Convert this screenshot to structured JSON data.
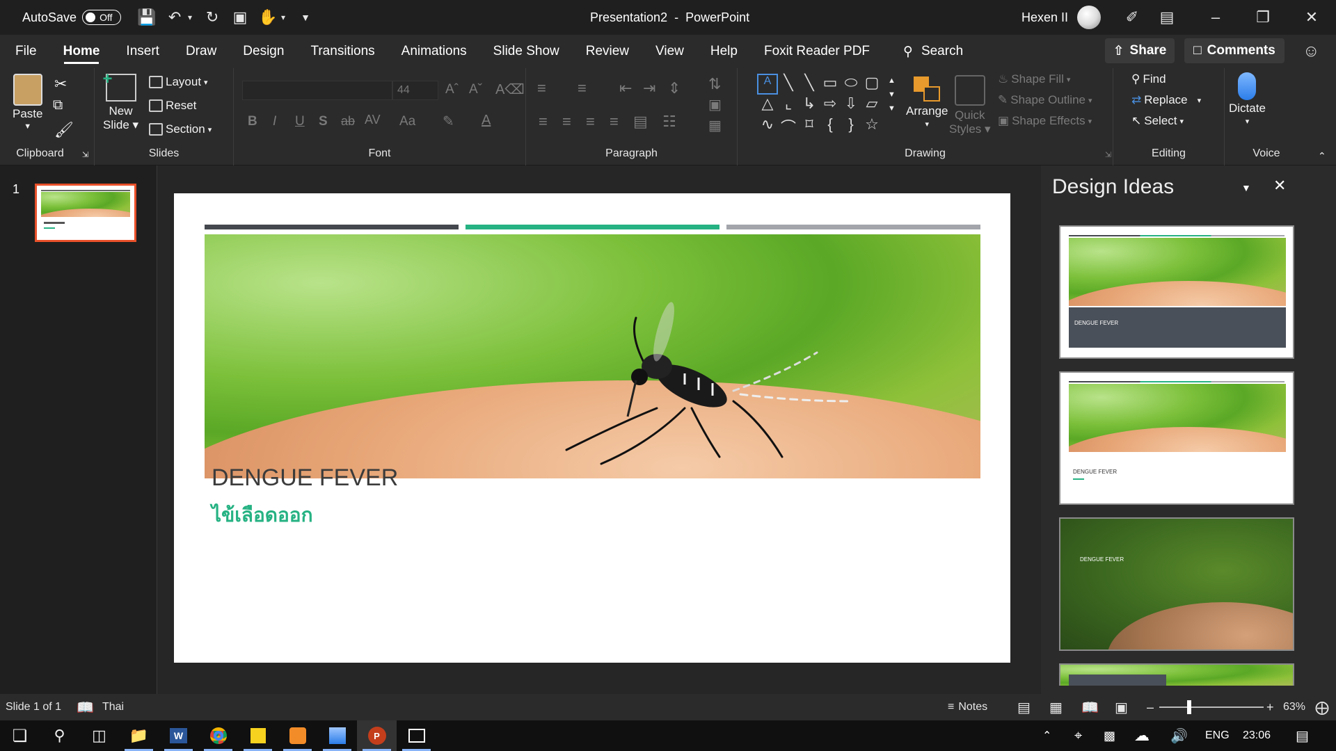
{
  "titlebar": {
    "autosave_label": "AutoSave",
    "autosave_state": "Off",
    "title": "Presentation2  -  PowerPoint",
    "user": "Hexen II"
  },
  "tabs": [
    "File",
    "Home",
    "Insert",
    "Draw",
    "Design",
    "Transitions",
    "Animations",
    "Slide Show",
    "Review",
    "View",
    "Help",
    "Foxit Reader PDF"
  ],
  "search_label": "Search",
  "share_label": "Share",
  "comments_label": "Comments",
  "ribbon": {
    "clipboard": {
      "label": "Clipboard",
      "paste": "Paste"
    },
    "slides": {
      "label": "Slides",
      "new_slide_1": "New",
      "new_slide_2": "Slide",
      "layout": "Layout",
      "reset": "Reset",
      "section": "Section"
    },
    "font": {
      "label": "Font",
      "size": "44",
      "bold": "B",
      "italic": "I",
      "underline": "U",
      "shadow": "S",
      "strike": "ab",
      "spacing": "AV",
      "case": "Aa",
      "color": "A"
    },
    "paragraph": {
      "label": "Paragraph"
    },
    "drawing": {
      "label": "Drawing",
      "arrange": "Arrange",
      "quick_styles_1": "Quick",
      "quick_styles_2": "Styles",
      "shape_fill": "Shape Fill",
      "shape_outline": "Shape Outline",
      "shape_effects": "Shape Effects"
    },
    "editing": {
      "label": "Editing",
      "find": "Find",
      "replace": "Replace",
      "select": "Select"
    },
    "voice": {
      "label": "Voice",
      "dictate": "Dictate"
    }
  },
  "thumb": {
    "number": "1"
  },
  "slide": {
    "title": "DENGUE FEVER",
    "subtitle": "ไข้เลือดออก",
    "bar_colors": [
      "#44484e",
      "#26b283",
      "#a3a5ab"
    ]
  },
  "design_ideas": {
    "title": "Design Ideas",
    "card_title": "DENGUE FEVER"
  },
  "status": {
    "slide_info": "Slide 1 of 1",
    "language": "Thai",
    "notes": "Notes",
    "zoom": "63%",
    "zoom_level": 0.63
  },
  "taskbar": {
    "lang": "ENG",
    "time": "23:06"
  },
  "colors": {
    "accent": "#26b283",
    "ppt_orange": "#c43e1c",
    "selection": "#e9512a"
  }
}
